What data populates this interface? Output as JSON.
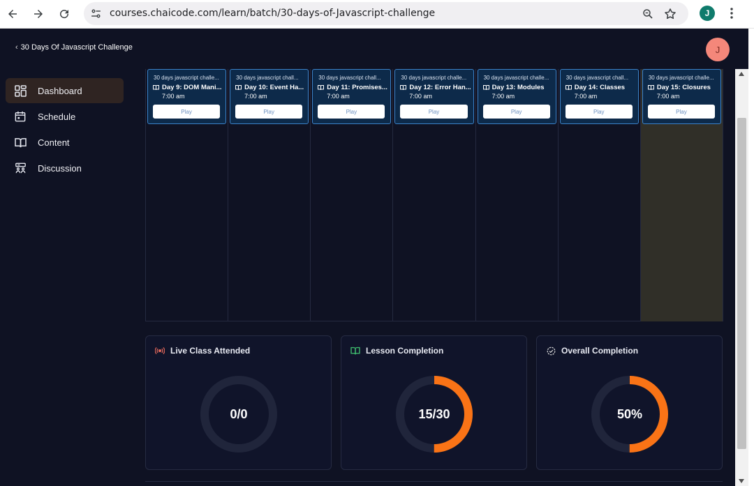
{
  "browser": {
    "url": "courses.chaicode.com/learn/batch/30-days-of-Javascript-challenge",
    "profile_initial": "J"
  },
  "header": {
    "back_label": "30 Days Of Javascript Challenge",
    "avatar_initial": "J"
  },
  "sidebar": {
    "items": [
      {
        "label": "Dashboard",
        "icon": "dashboard-grid-icon",
        "active": true
      },
      {
        "label": "Schedule",
        "icon": "calendar-icon",
        "active": false
      },
      {
        "label": "Content",
        "icon": "book-open-icon",
        "active": false
      },
      {
        "label": "Discussion",
        "icon": "discussion-icon",
        "active": false
      }
    ]
  },
  "calendar": {
    "events": [
      {
        "batch": "30 days javascript challe...",
        "title": "Day 9: DOM Mani...",
        "time": "7:00 am",
        "play": "Play"
      },
      {
        "batch": "30 days javascript chall...",
        "title": "Day 10: Event Ha...",
        "time": "7:00 am",
        "play": "Play"
      },
      {
        "batch": "30 days javascript chall...",
        "title": "Day 11: Promises...",
        "time": "7:00 am",
        "play": "Play"
      },
      {
        "batch": "30 days javascript challe...",
        "title": "Day 12: Error Han...",
        "time": "7:00 am",
        "play": "Play"
      },
      {
        "batch": "30 days javascript challe...",
        "title": "Day 13: Modules",
        "time": "7:00 am",
        "play": "Play"
      },
      {
        "batch": "30 days javascript chall...",
        "title": "Day 14: Classes",
        "time": "7:00 am",
        "play": "Play"
      },
      {
        "batch": "30 days javascript challe...",
        "title": "Day 15: Closures",
        "time": "7:00 am",
        "play": "Play"
      }
    ],
    "today_index": 6
  },
  "stats": [
    {
      "label": "Live Class Attended",
      "icon": "live-broadcast-icon",
      "value": "0/0",
      "progress": 0,
      "icon_color": "#e0675a"
    },
    {
      "label": "Lesson Completion",
      "icon": "book-open-icon",
      "value": "15/30",
      "progress": 0.5,
      "icon_color": "#3fbf6f"
    },
    {
      "label": "Overall Completion",
      "icon": "check-badge-icon",
      "value": "50%",
      "progress": 0.5,
      "icon_color": "#d9d9d9"
    }
  ],
  "colors": {
    "background": "#0f1223",
    "accent_orange": "#f97316",
    "ring_track": "#20253b",
    "event_bg": "#0d2a4a",
    "event_border": "#3b82c9"
  }
}
